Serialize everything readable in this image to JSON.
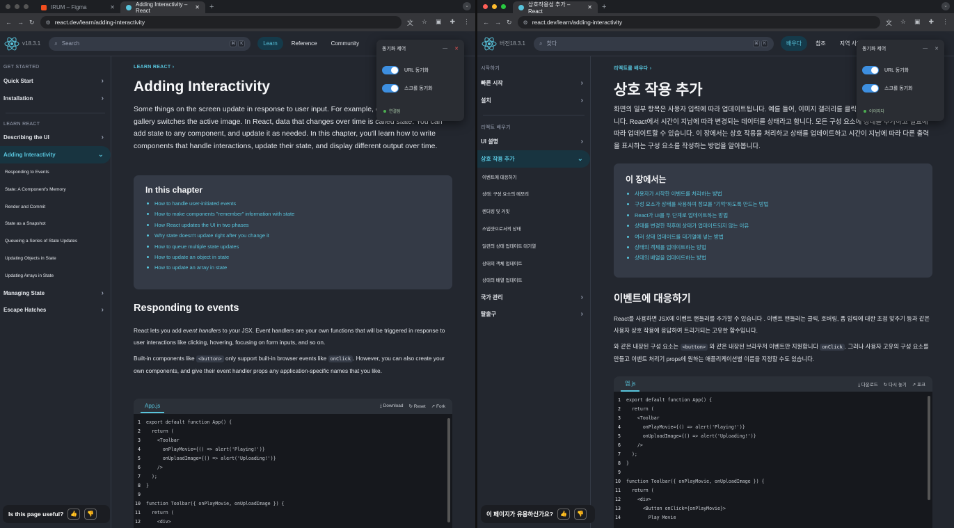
{
  "left": {
    "tabs": [
      {
        "title": "IRUM – Figma",
        "color": "#f24e1e"
      },
      {
        "title": "Adding Interactivity – React",
        "color": "#58c4dc"
      }
    ],
    "url": "react.dev/learn/adding-interactivity",
    "version": "v18.3.1",
    "search_placeholder": "Search",
    "kbd": [
      "⌘",
      "K"
    ],
    "nav": [
      "Learn",
      "Reference",
      "Community"
    ],
    "sidebar": {
      "sec1": "GET STARTED",
      "items1": [
        "Quick Start",
        "Installation"
      ],
      "sec2": "LEARN REACT",
      "items2": [
        "Describing the UI",
        "Adding Interactivity"
      ],
      "subs": [
        "Responding to Events",
        "State: A Component's Memory",
        "Render and Commit",
        "State as a Snapshot",
        "Queueing a Series of State Updates",
        "Updating Objects in State",
        "Updating Arrays in State"
      ],
      "items3": [
        "Managing State",
        "Escape Hatches"
      ]
    },
    "breadcrumb": "LEARN REACT",
    "title": "Adding Interactivity",
    "intro_pre": "Some things on the screen update in response to user input. For example, clicking an image gallery switches the active image. In React, data that changes over time is called ",
    "intro_em": "state",
    "intro_post": ". You can add state to any component, and update it as needed. In this chapter, you'll learn how to write components that handle interactions, update their state, and display different output over time.",
    "chapter_title": "In this chapter",
    "chapter_items": [
      "How to handle user-initiated events",
      "How to make components \"remember\" information with state",
      "How React updates the UI in two phases",
      "Why state doesn't update right after you change it",
      "How to queue multiple state updates",
      "How to update an object in state",
      "How to update an array in state"
    ],
    "h2": "Responding to events",
    "p1_a": "React lets you add ",
    "p1_em": "event handlers",
    "p1_b": " to your JSX. Event handlers are your own functions that will be triggered in response to user interactions like clicking, hovering, focusing on form inputs, and so on.",
    "p2_a": "Built-in components like ",
    "p2_code1": "<button>",
    "p2_b": " only support built-in browser events like ",
    "p2_code2": "onClick",
    "p2_c": ". However, you can also create your own components, and give their event handler props any application-specific names that you like.",
    "code_file": "App.js",
    "code_actions": [
      "⤓ Download",
      "↻ Reset",
      "↗ Fork"
    ],
    "useful": "Is this page useful?",
    "popup": {
      "title": "동기화 제어",
      "t1": "URL 동기화",
      "t2": "스크롤 동기화",
      "status": "연결됨"
    }
  },
  "right": {
    "tab": "상호작용성 추가 – React",
    "url": "react.dev/learn/adding-interactivity",
    "version": "버전18.3.1",
    "search_placeholder": "찾다",
    "nav": [
      "배우다",
      "참조",
      "지역 사회"
    ],
    "sidebar": {
      "sec1": "시작하기",
      "items1": [
        "빠른 시작",
        "설치"
      ],
      "sec2": "리액트 배우기",
      "items2": [
        "UI 설명",
        "상호 작용 추가"
      ],
      "subs": [
        "이벤트에 대응하기",
        "상태: 구성 요소의 메모리",
        "렌더링 및 커밋",
        "스냅샷으로서의 상태",
        "일련의 상태 업데이트 대기열",
        "상태의 객체 업데이트",
        "상태의 배열 업데이트"
      ],
      "items3": [
        "국가 관리",
        "탈출구"
      ]
    },
    "breadcrumb": "리액트를 배우다",
    "title": "상호 작용 추가",
    "intro": "화면의 일부 항목은 사용자 입력에 따라 업데이트됩니다. 예를 들어, 이미지 갤러리를 클릭하면 활성 이미지가 전환됩니다. React에서 시간이 지남에 따라 변경되는 데이터를 상태라고 합니다. 모든 구성 요소에 상태를 추가하고 필요에 따라 업데이트할 수 있습니다. 이 장에서는 상호 작용을 처리하고 상태를 업데이트하고 시간이 지남에 따라 다른 출력을 표시하는 구성 요소를 작성하는 방법을 알아봅니다.",
    "chapter_title": "이 장에서는",
    "chapter_items": [
      "사용자가 시작한 이벤트를 처리하는 방법",
      "구성 요소가 상태를 사용하여 정보를 \"기억\"하도록 만드는 방법",
      "React가 UI를 두 단계로 업데이트하는 방법",
      "상태를 변경한 직후에 상태가 업데이트되지 않는 이유",
      "여러 상태 업데이트를 대기열에 넣는 방법",
      "상태의 객체를 업데이트하는 방법",
      "상태의 배열을 업데이트하는 방법"
    ],
    "h2": "이벤트에 대응하기",
    "p1": "React를 사용하면 JSX에 이벤트 핸들러를 추가할 수 있습니다 . 이벤트 핸들러는 클릭, 호버링, 폼 입력에 대한 초점 맞추기 등과 같은 사용자 상호 작용에 응답하여 트리거되는 고유한 함수입니다.",
    "p2_a": "와 같은 내장된 구성 요소는 ",
    "p2_code1": "<button>",
    "p2_b": " 와 같은 내장된 브라우저 이벤트만 지원합니다 ",
    "p2_code2": "onClick",
    "p2_c": ". 그러나 사용자 고유의 구성 요소를 만들고 이벤트 처리기 props에 원하는 애플리케이션별 이름을 지정할 수도 있습니다.",
    "code_file": "앱.js",
    "code_actions": [
      "⤓ 다운로드",
      "↻ 다시 놓기",
      "↗ 포크"
    ],
    "useful": "이 페이지가 유용하신가요?",
    "popup": {
      "title": "동기화 제어",
      "t1": "URL 동기화",
      "t2": "스크롤 동기화",
      "status": "이어지다"
    }
  },
  "code_left": [
    "export default function App() {",
    "  return (",
    "    <Toolbar",
    "      onPlayMovie={() => alert('Playing!')}",
    "      onUploadImage={() => alert('Uploading!')}",
    "    />",
    "  );",
    "}",
    "",
    "function Toolbar({ onPlayMovie, onUploadImage }) {",
    "  return (",
    "    <div>"
  ],
  "code_right": [
    "export default function App() {",
    "  return (",
    "    <Toolbar",
    "      onPlayMovie={() => alert('Playing!')}",
    "      onUploadImage={() => alert('Uploading!')}",
    "    />",
    "  );",
    "}",
    "",
    "function Toolbar({ onPlayMovie, onUploadImage }) {",
    "  return (",
    "    <div>",
    "      <Button onClick={onPlayMovie}>",
    "        Play Movie"
  ]
}
